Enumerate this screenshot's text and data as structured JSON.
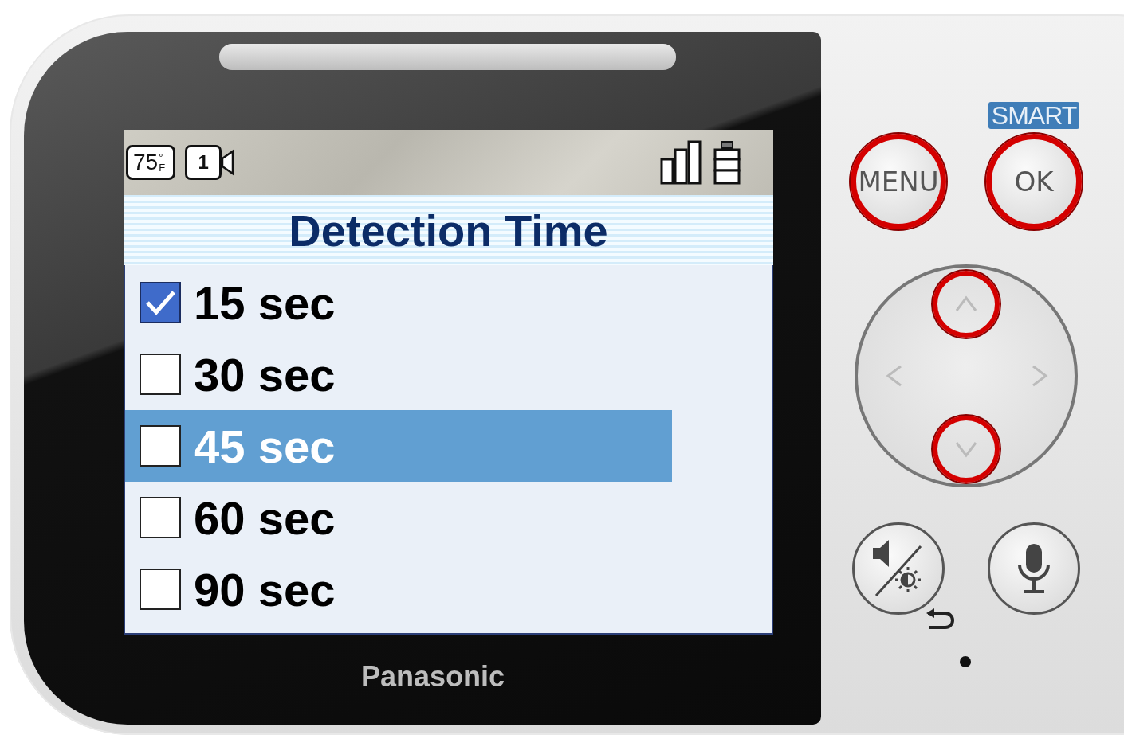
{
  "screen": {
    "status_bar": {
      "temperature": "75",
      "temperature_unit": "°F",
      "camera": "1"
    },
    "menu": {
      "title": "Detection Time",
      "options": [
        {
          "label": "15 sec",
          "checked": true,
          "selected": false
        },
        {
          "label": "30 sec",
          "checked": false,
          "selected": false
        },
        {
          "label": "45 sec",
          "checked": false,
          "selected": true
        },
        {
          "label": "60 sec",
          "checked": false,
          "selected": false
        },
        {
          "label": "90 sec",
          "checked": false,
          "selected": false
        }
      ]
    }
  },
  "brand": "Panasonic",
  "controls": {
    "smart_label": "SMART",
    "top_buttons": [
      {
        "label": "MENU",
        "highlighted": true
      },
      {
        "label": "OK",
        "highlighted": true
      }
    ],
    "dpad": [
      {
        "kind": "up",
        "highlighted": true
      },
      {
        "kind": "left",
        "highlighted": false
      },
      {
        "kind": "right",
        "highlighted": false
      },
      {
        "kind": "down",
        "highlighted": true
      }
    ],
    "bottom_buttons": [
      {
        "kind": "speaker-brightness",
        "highlighted": false
      },
      {
        "kind": "microphone",
        "highlighted": false
      }
    ]
  }
}
